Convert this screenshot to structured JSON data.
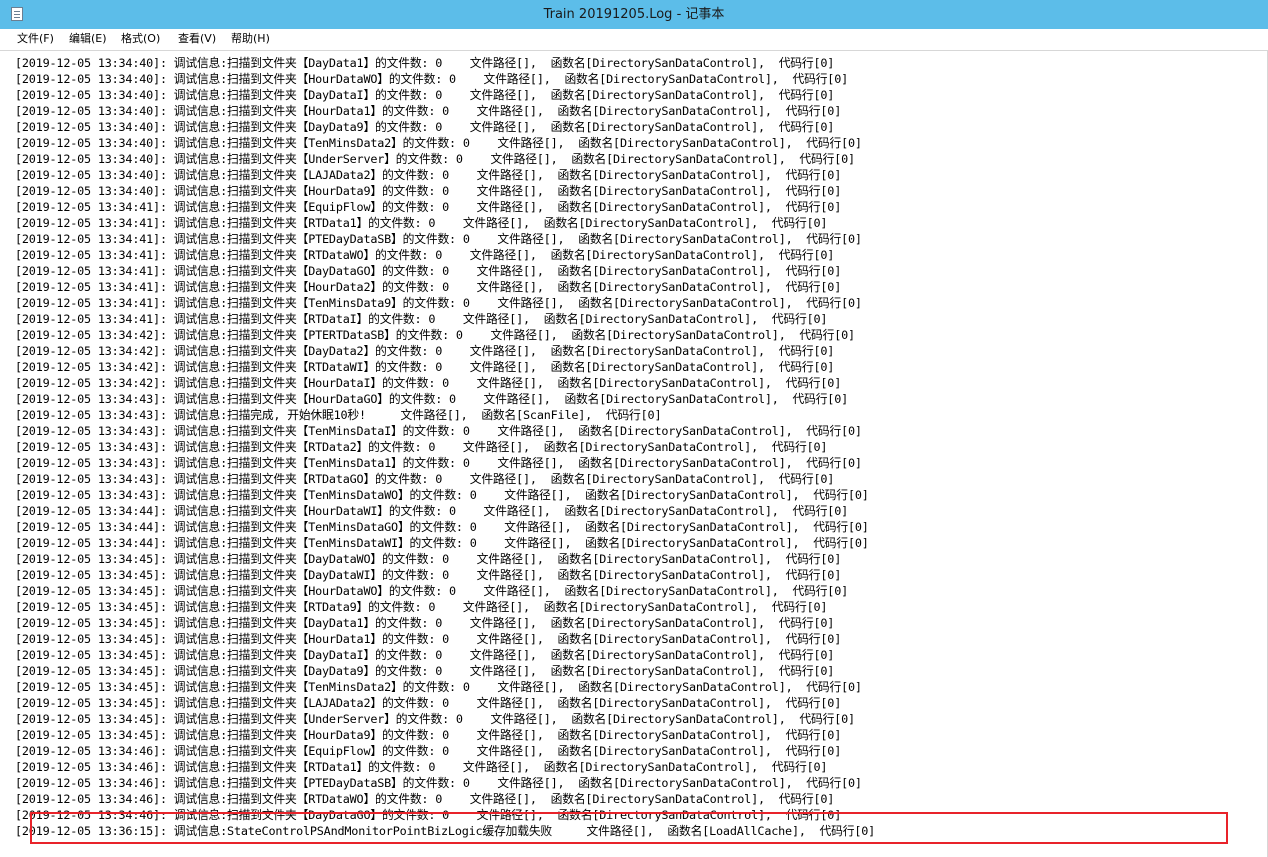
{
  "window": {
    "title": "Train 20191205.Log - 记事本",
    "icon": "notepad-icon"
  },
  "menu": [
    {
      "name": "menu-file",
      "label": "文件(F)"
    },
    {
      "name": "menu-edit",
      "label": "编辑(E)"
    },
    {
      "name": "menu-format",
      "label": "格式(O)"
    },
    {
      "name": "menu-view",
      "label": "查看(V)"
    },
    {
      "name": "menu-help",
      "label": "帮助(H)"
    }
  ],
  "editor": {
    "lines": [
      "[2019-12-05 13:34:40]: 调试信息:扫描到文件夹【DayData1】的文件数: 0    文件路径[],  函数名[DirectorySanDataControl],  代码行[0]",
      "[2019-12-05 13:34:40]: 调试信息:扫描到文件夹【HourDataWO】的文件数: 0    文件路径[],  函数名[DirectorySanDataControl],  代码行[0]",
      "[2019-12-05 13:34:40]: 调试信息:扫描到文件夹【DayDataI】的文件数: 0    文件路径[],  函数名[DirectorySanDataControl],  代码行[0]",
      "[2019-12-05 13:34:40]: 调试信息:扫描到文件夹【HourData1】的文件数: 0    文件路径[],  函数名[DirectorySanDataControl],  代码行[0]",
      "[2019-12-05 13:34:40]: 调试信息:扫描到文件夹【DayData9】的文件数: 0    文件路径[],  函数名[DirectorySanDataControl],  代码行[0]",
      "[2019-12-05 13:34:40]: 调试信息:扫描到文件夹【TenMinsData2】的文件数: 0    文件路径[],  函数名[DirectorySanDataControl],  代码行[0]",
      "[2019-12-05 13:34:40]: 调试信息:扫描到文件夹【UnderServer】的文件数: 0    文件路径[],  函数名[DirectorySanDataControl],  代码行[0]",
      "[2019-12-05 13:34:40]: 调试信息:扫描到文件夹【LAJAData2】的文件数: 0    文件路径[],  函数名[DirectorySanDataControl],  代码行[0]",
      "[2019-12-05 13:34:40]: 调试信息:扫描到文件夹【HourData9】的文件数: 0    文件路径[],  函数名[DirectorySanDataControl],  代码行[0]",
      "[2019-12-05 13:34:41]: 调试信息:扫描到文件夹【EquipFlow】的文件数: 0    文件路径[],  函数名[DirectorySanDataControl],  代码行[0]",
      "[2019-12-05 13:34:41]: 调试信息:扫描到文件夹【RTData1】的文件数: 0    文件路径[],  函数名[DirectorySanDataControl],  代码行[0]",
      "[2019-12-05 13:34:41]: 调试信息:扫描到文件夹【PTEDayDataSB】的文件数: 0    文件路径[],  函数名[DirectorySanDataControl],  代码行[0]",
      "[2019-12-05 13:34:41]: 调试信息:扫描到文件夹【RTDataWO】的文件数: 0    文件路径[],  函数名[DirectorySanDataControl],  代码行[0]",
      "[2019-12-05 13:34:41]: 调试信息:扫描到文件夹【DayDataGO】的文件数: 0    文件路径[],  函数名[DirectorySanDataControl],  代码行[0]",
      "[2019-12-05 13:34:41]: 调试信息:扫描到文件夹【HourData2】的文件数: 0    文件路径[],  函数名[DirectorySanDataControl],  代码行[0]",
      "[2019-12-05 13:34:41]: 调试信息:扫描到文件夹【TenMinsData9】的文件数: 0    文件路径[],  函数名[DirectorySanDataControl],  代码行[0]",
      "[2019-12-05 13:34:41]: 调试信息:扫描到文件夹【RTDataI】的文件数: 0    文件路径[],  函数名[DirectorySanDataControl],  代码行[0]",
      "[2019-12-05 13:34:42]: 调试信息:扫描到文件夹【PTERTDataSB】的文件数: 0    文件路径[],  函数名[DirectorySanDataControl],  代码行[0]",
      "[2019-12-05 13:34:42]: 调试信息:扫描到文件夹【DayData2】的文件数: 0    文件路径[],  函数名[DirectorySanDataControl],  代码行[0]",
      "[2019-12-05 13:34:42]: 调试信息:扫描到文件夹【RTDataWI】的文件数: 0    文件路径[],  函数名[DirectorySanDataControl],  代码行[0]",
      "[2019-12-05 13:34:42]: 调试信息:扫描到文件夹【HourDataI】的文件数: 0    文件路径[],  函数名[DirectorySanDataControl],  代码行[0]",
      "[2019-12-05 13:34:43]: 调试信息:扫描到文件夹【HourDataGO】的文件数: 0    文件路径[],  函数名[DirectorySanDataControl],  代码行[0]",
      "[2019-12-05 13:34:43]: 调试信息:扫描完成, 开始休眠10秒!     文件路径[],  函数名[ScanFile],  代码行[0]",
      "[2019-12-05 13:34:43]: 调试信息:扫描到文件夹【TenMinsDataI】的文件数: 0    文件路径[],  函数名[DirectorySanDataControl],  代码行[0]",
      "[2019-12-05 13:34:43]: 调试信息:扫描到文件夹【RTData2】的文件数: 0    文件路径[],  函数名[DirectorySanDataControl],  代码行[0]",
      "[2019-12-05 13:34:43]: 调试信息:扫描到文件夹【TenMinsData1】的文件数: 0    文件路径[],  函数名[DirectorySanDataControl],  代码行[0]",
      "[2019-12-05 13:34:43]: 调试信息:扫描到文件夹【RTDataGO】的文件数: 0    文件路径[],  函数名[DirectorySanDataControl],  代码行[0]",
      "[2019-12-05 13:34:43]: 调试信息:扫描到文件夹【TenMinsDataWO】的文件数: 0    文件路径[],  函数名[DirectorySanDataControl],  代码行[0]",
      "[2019-12-05 13:34:44]: 调试信息:扫描到文件夹【HourDataWI】的文件数: 0    文件路径[],  函数名[DirectorySanDataControl],  代码行[0]",
      "[2019-12-05 13:34:44]: 调试信息:扫描到文件夹【TenMinsDataGO】的文件数: 0    文件路径[],  函数名[DirectorySanDataControl],  代码行[0]",
      "[2019-12-05 13:34:44]: 调试信息:扫描到文件夹【TenMinsDataWI】的文件数: 0    文件路径[],  函数名[DirectorySanDataControl],  代码行[0]",
      "[2019-12-05 13:34:45]: 调试信息:扫描到文件夹【DayDataWO】的文件数: 0    文件路径[],  函数名[DirectorySanDataControl],  代码行[0]",
      "[2019-12-05 13:34:45]: 调试信息:扫描到文件夹【DayDataWI】的文件数: 0    文件路径[],  函数名[DirectorySanDataControl],  代码行[0]",
      "[2019-12-05 13:34:45]: 调试信息:扫描到文件夹【HourDataWO】的文件数: 0    文件路径[],  函数名[DirectorySanDataControl],  代码行[0]",
      "[2019-12-05 13:34:45]: 调试信息:扫描到文件夹【RTData9】的文件数: 0    文件路径[],  函数名[DirectorySanDataControl],  代码行[0]",
      "[2019-12-05 13:34:45]: 调试信息:扫描到文件夹【DayData1】的文件数: 0    文件路径[],  函数名[DirectorySanDataControl],  代码行[0]",
      "[2019-12-05 13:34:45]: 调试信息:扫描到文件夹【HourData1】的文件数: 0    文件路径[],  函数名[DirectorySanDataControl],  代码行[0]",
      "[2019-12-05 13:34:45]: 调试信息:扫描到文件夹【DayDataI】的文件数: 0    文件路径[],  函数名[DirectorySanDataControl],  代码行[0]",
      "[2019-12-05 13:34:45]: 调试信息:扫描到文件夹【DayData9】的文件数: 0    文件路径[],  函数名[DirectorySanDataControl],  代码行[0]",
      "[2019-12-05 13:34:45]: 调试信息:扫描到文件夹【TenMinsData2】的文件数: 0    文件路径[],  函数名[DirectorySanDataControl],  代码行[0]",
      "[2019-12-05 13:34:45]: 调试信息:扫描到文件夹【LAJAData2】的文件数: 0    文件路径[],  函数名[DirectorySanDataControl],  代码行[0]",
      "[2019-12-05 13:34:45]: 调试信息:扫描到文件夹【UnderServer】的文件数: 0    文件路径[],  函数名[DirectorySanDataControl],  代码行[0]",
      "[2019-12-05 13:34:45]: 调试信息:扫描到文件夹【HourData9】的文件数: 0    文件路径[],  函数名[DirectorySanDataControl],  代码行[0]",
      "[2019-12-05 13:34:46]: 调试信息:扫描到文件夹【EquipFlow】的文件数: 0    文件路径[],  函数名[DirectorySanDataControl],  代码行[0]",
      "[2019-12-05 13:34:46]: 调试信息:扫描到文件夹【RTData1】的文件数: 0    文件路径[],  函数名[DirectorySanDataControl],  代码行[0]",
      "[2019-12-05 13:34:46]: 调试信息:扫描到文件夹【PTEDayDataSB】的文件数: 0    文件路径[],  函数名[DirectorySanDataControl],  代码行[0]",
      "[2019-12-05 13:34:46]: 调试信息:扫描到文件夹【RTDataWO】的文件数: 0    文件路径[],  函数名[DirectorySanDataControl],  代码行[0]",
      "[2019-12-05 13:34:46]: 调试信息:扫描到文件夹【DayDataGO】的文件数: 0    文件路径[],  函数名[DirectorySanDataControl],  代码行[0]",
      "[2019-12-05 13:36:15]: 调试信息:StateControlPSAndMonitorPointBizLogic缓存加载失败     文件路径[],  函数名[LoadAllCache],  代码行[0]"
    ]
  },
  "highlight": {
    "color": "#e8232a",
    "marked_line": 49
  },
  "colors": {
    "titlebar": "#5cbde9",
    "text": "#000000",
    "background": "#ffffff"
  }
}
